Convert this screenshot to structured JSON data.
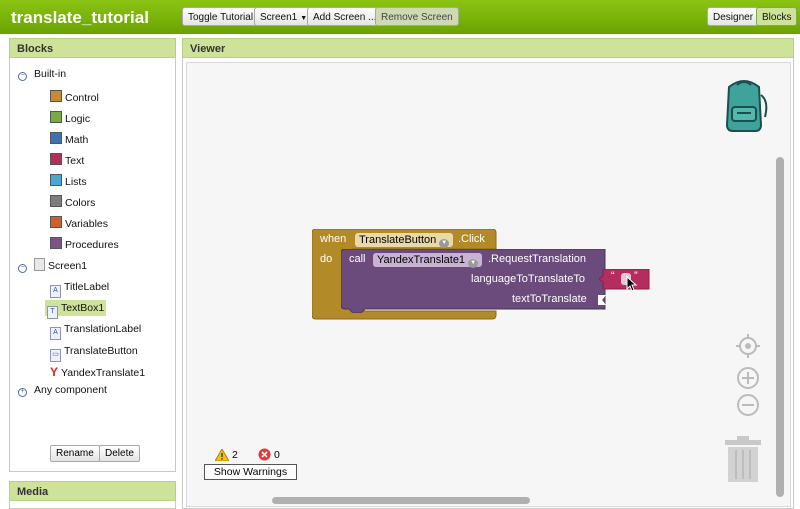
{
  "app": {
    "title": "translate_tutorial"
  },
  "toolbar": {
    "toggle_tutorial": "Toggle Tutorial",
    "screen_select": "Screen1",
    "add_screen": "Add Screen ...",
    "remove_screen": "Remove Screen",
    "designer": "Designer",
    "blocks": "Blocks"
  },
  "blocks_panel": {
    "title": "Blocks",
    "builtin_label": "Built-in",
    "builtin_items": [
      {
        "label": "Control",
        "color": "#c88a30"
      },
      {
        "label": "Logic",
        "color": "#77ab41"
      },
      {
        "label": "Math",
        "color": "#3f71b5"
      },
      {
        "label": "Text",
        "color": "#b32d5e"
      },
      {
        "label": "Lists",
        "color": "#49a6d4"
      },
      {
        "label": "Colors",
        "color": "#7d7d7d"
      },
      {
        "label": "Variables",
        "color": "#d05f2d"
      },
      {
        "label": "Procedures",
        "color": "#7c5385"
      }
    ],
    "screen_label": "Screen1",
    "components": [
      "TitleLabel",
      "TextBox1",
      "TranslationLabel",
      "TranslateButton",
      "YandexTranslate1"
    ],
    "any_component": "Any component",
    "rename": "Rename",
    "delete": "Delete"
  },
  "media_panel": {
    "title": "Media"
  },
  "viewer": {
    "title": "Viewer",
    "event_block": {
      "when": "when",
      "component": "TranslateButton",
      "event": ".Click",
      "do": "do"
    },
    "call_block": {
      "call": "call",
      "component": "YandexTranslate1",
      "method": ".RequestTranslation",
      "arg1": "languageToTranslateTo",
      "arg2": "textToTranslate"
    },
    "text_block": {
      "open_quote": "“",
      "close_quote": "”"
    },
    "warnings_count": "2",
    "errors_count": "0",
    "show_warnings": "Show Warnings"
  },
  "colors": {
    "topbar": "#6fad00",
    "event_block": "#b28a28",
    "call_block": "#6b4a7c",
    "text_block": "#b32d5e"
  }
}
